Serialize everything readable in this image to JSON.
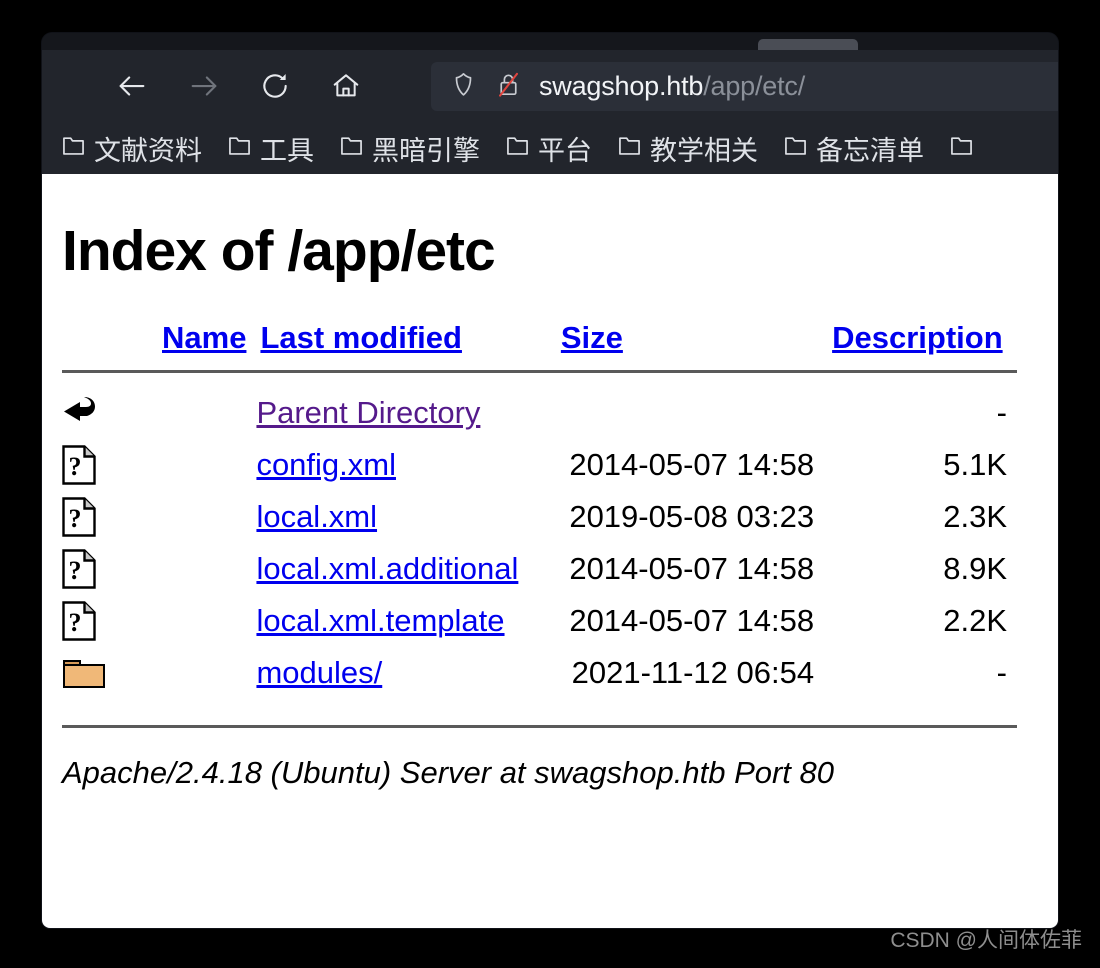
{
  "browser": {
    "nav": {
      "back_label": "Back",
      "forward_label": "Forward",
      "reload_label": "Reload",
      "home_label": "Home"
    },
    "url": {
      "host": "swagshop.htb",
      "path": "/app/etc/",
      "full": "swagshop.htb/app/etc/",
      "security_icon": "shield-icon",
      "connection_icon": "lock-broken-icon",
      "connection_state": "not-secure"
    },
    "bookmarks": [
      {
        "label": "文献资料",
        "icon": "folder-icon"
      },
      {
        "label": "工具",
        "icon": "folder-icon"
      },
      {
        "label": "黑暗引擎",
        "icon": "folder-icon"
      },
      {
        "label": "平台",
        "icon": "folder-icon"
      },
      {
        "label": "教学相关",
        "icon": "folder-icon"
      },
      {
        "label": "备忘清单",
        "icon": "folder-icon"
      },
      {
        "label": "",
        "icon": "folder-icon"
      }
    ]
  },
  "page": {
    "title": "Index of /app/etc",
    "columns": {
      "name": "Name",
      "last_modified": "Last modified",
      "size": "Size",
      "description": "Description"
    },
    "rows": [
      {
        "icon": "parent-directory-icon",
        "name": "Parent Directory",
        "last_modified": "",
        "size": "-",
        "description": "",
        "visited": true
      },
      {
        "icon": "unknown-file-icon",
        "name": "config.xml",
        "last_modified": "2014-05-07 14:58",
        "size": "5.1K",
        "description": "",
        "visited": false
      },
      {
        "icon": "unknown-file-icon",
        "name": "local.xml",
        "last_modified": "2019-05-08 03:23",
        "size": "2.3K",
        "description": "",
        "visited": false
      },
      {
        "icon": "unknown-file-icon",
        "name": "local.xml.additional",
        "last_modified": "2014-05-07 14:58",
        "size": "8.9K",
        "description": "",
        "visited": false
      },
      {
        "icon": "unknown-file-icon",
        "name": "local.xml.template",
        "last_modified": "2014-05-07 14:58",
        "size": "2.2K",
        "description": "",
        "visited": false
      },
      {
        "icon": "folder-directory-icon",
        "name": "modules/",
        "last_modified": "2021-11-12 06:54",
        "size": "-",
        "description": "",
        "visited": false
      }
    ],
    "footer": "Apache/2.4.18 (Ubuntu) Server at swagshop.htb Port 80"
  },
  "watermark": "CSDN @人间体佐菲",
  "colors": {
    "link": "#0000EE",
    "visited_link": "#551A8B",
    "chrome_bg": "#22252C",
    "chrome_tabstrip": "#15171C",
    "urlbar_bg": "#2B2F38",
    "page_bg": "#FFFFFF",
    "desktop_bg": "#000000",
    "rule": "#5A5A5A",
    "folder_icon": "#F0B878"
  }
}
